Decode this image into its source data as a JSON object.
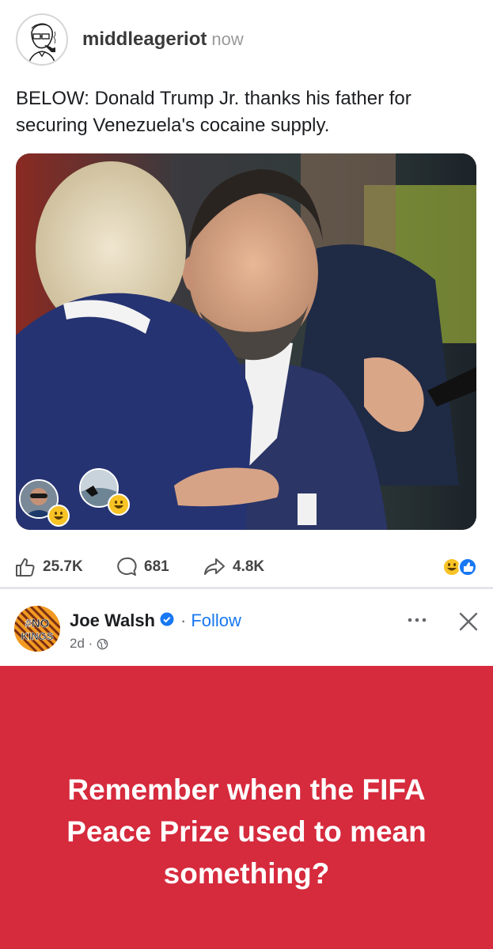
{
  "post1": {
    "author": "middleageriot",
    "time": "now",
    "caption": "BELOW: Donald Trump Jr. thanks his father for securing Venezuela's cocaine supply.",
    "reactions": [
      "smiley-face-emoji",
      "smiley-face-emoji"
    ],
    "stats": {
      "likes": "25.7K",
      "comments": "681",
      "shares": "4.8K"
    },
    "reaction_summary": [
      "laugh-emoji",
      "like-icon"
    ]
  },
  "post2": {
    "author": "Joe Walsh",
    "follow_sep": "·",
    "follow_label": "Follow",
    "age": "2d ·",
    "avatar_text_top": "#NO",
    "avatar_text_bottom": "KINGS",
    "banner_text": "Remember when the FIFA Peace Prize used to mean something?",
    "banner_color": "#d62a3d"
  },
  "colors": {
    "link": "#1877f2",
    "verified": "#1877f2"
  }
}
